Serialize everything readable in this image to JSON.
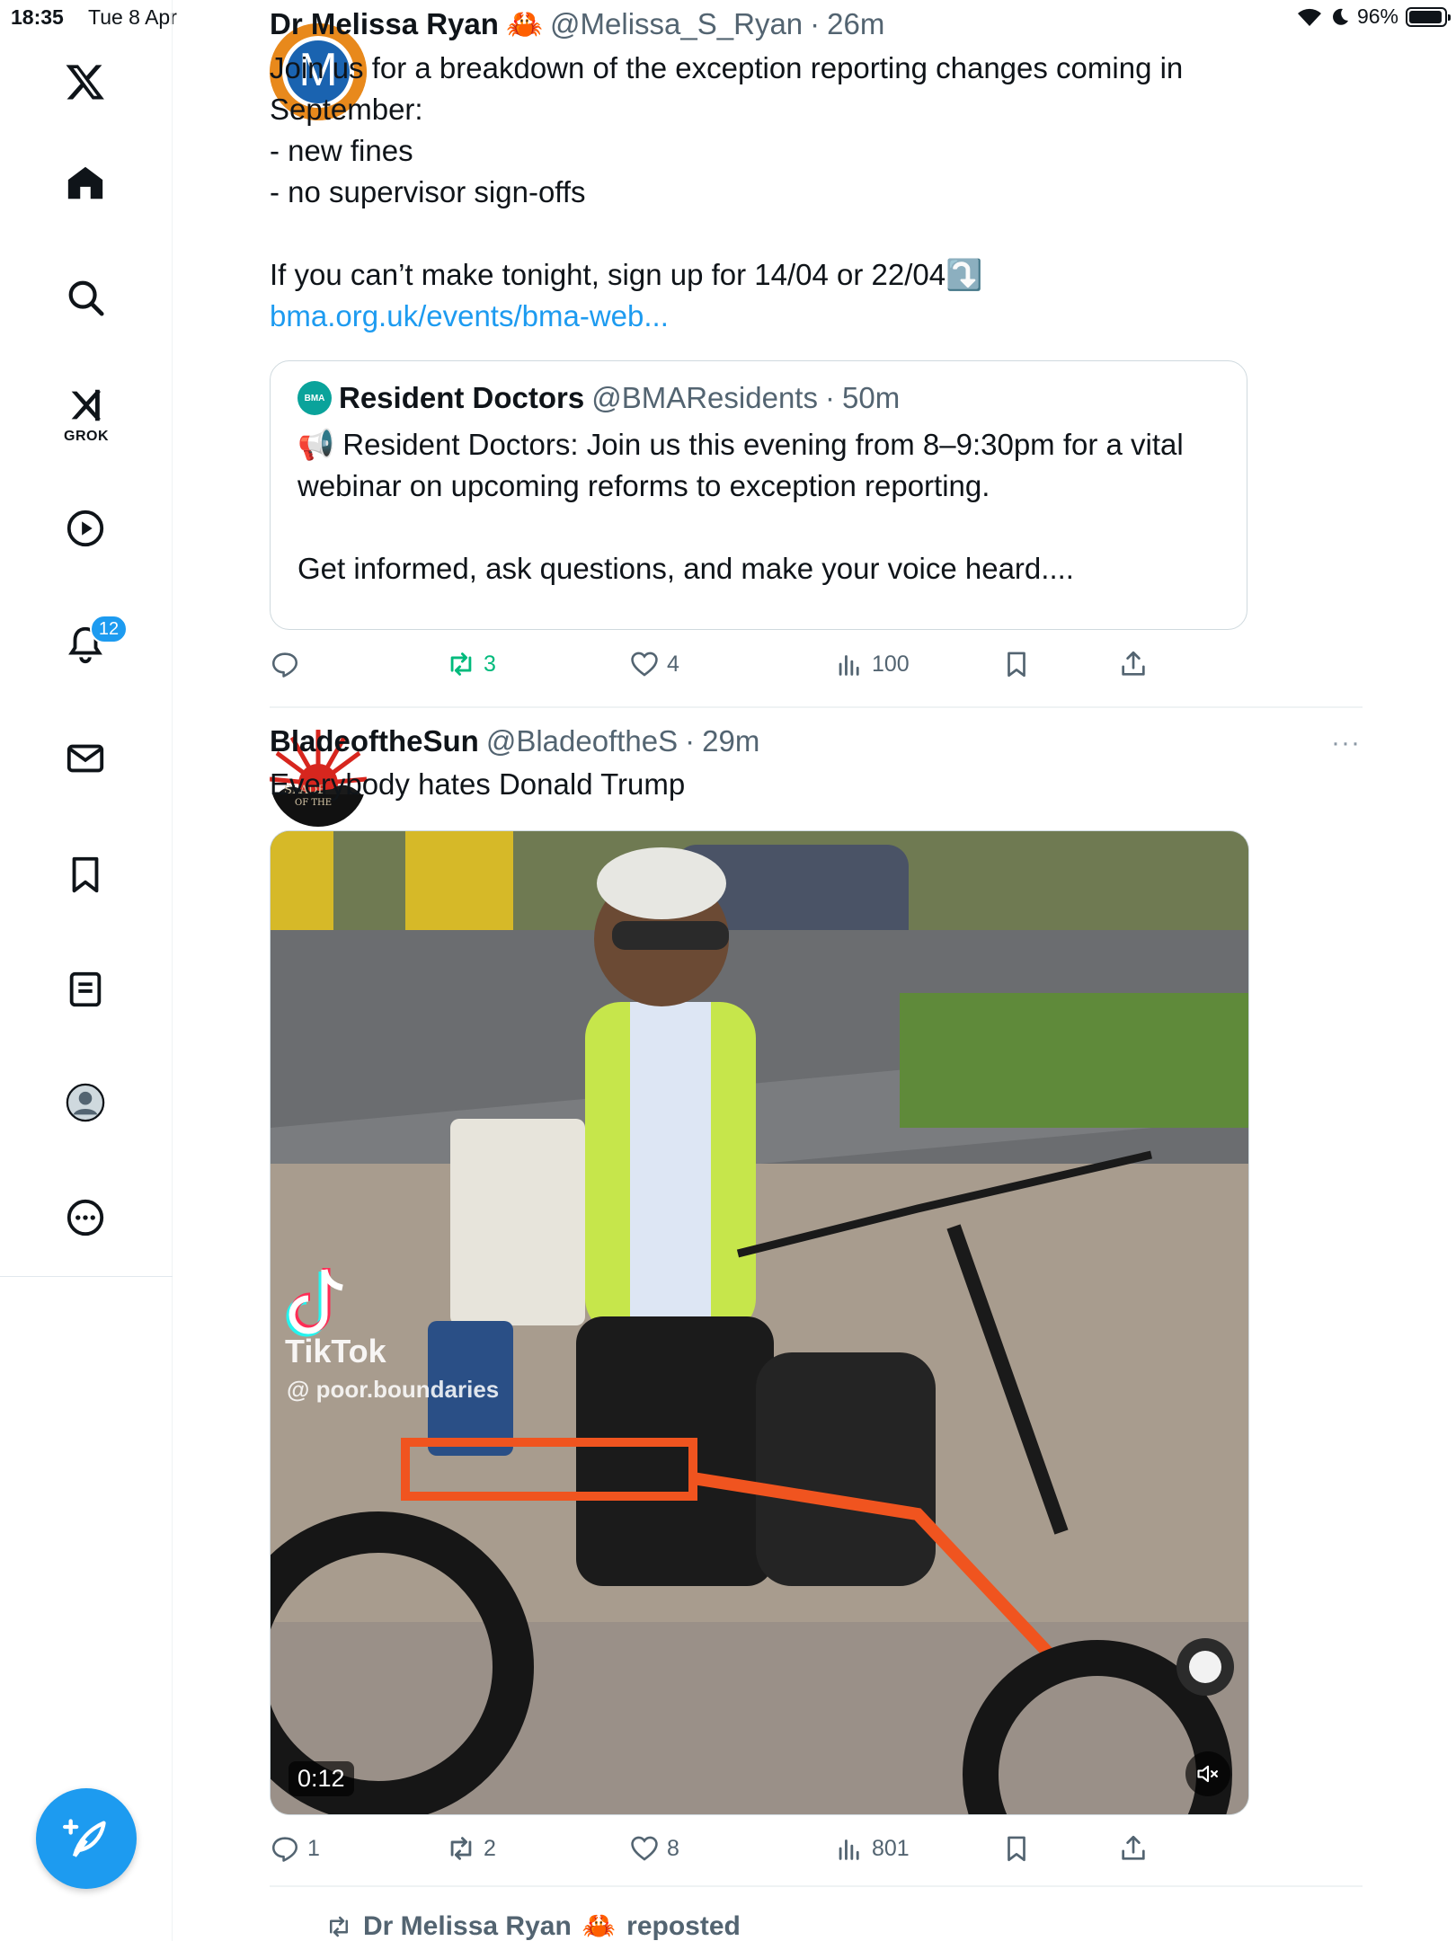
{
  "status_bar": {
    "time": "18:35",
    "date": "Tue 8 Apr",
    "battery": "96%",
    "battery_level": 0.96
  },
  "sidebar": {
    "items": [
      {
        "name": "home",
        "icon": "home-icon"
      },
      {
        "name": "explore",
        "icon": "search-icon"
      },
      {
        "name": "grok",
        "icon": "grok-icon",
        "label": "GROK"
      },
      {
        "name": "videos",
        "icon": "play-icon"
      },
      {
        "name": "notifications",
        "icon": "bell-icon",
        "badge": "12"
      },
      {
        "name": "messages",
        "icon": "mail-icon"
      },
      {
        "name": "bookmarks",
        "icon": "bookmark-icon"
      },
      {
        "name": "articles",
        "icon": "article-icon"
      },
      {
        "name": "profile",
        "icon": "profile-icon"
      },
      {
        "name": "more",
        "icon": "more-circle-icon"
      }
    ]
  },
  "tweets": [
    {
      "name": "Dr Melissa Ryan",
      "emoji": "🦀",
      "handle": "@Melissa_S_Ryan",
      "time": "26m",
      "avatar_letter": "M",
      "body_lines": [
        "Join us for a breakdown of the exception reporting changes coming in",
        "September:",
        "- new fines",
        "- no supervisor sign-offs",
        "",
        "If you can’t make tonight, sign up for 14/04 or 22/04⤵️"
      ],
      "link": "bma.org.uk/events/bma-web...",
      "quote": {
        "logo": "BMA",
        "name": "Resident Doctors",
        "handle": "@BMAResidents",
        "time": "50m",
        "body_line1": "📢 Resident Doctors: Join us this evening from 8–9:30pm for a vital",
        "body_line2": "webinar on upcoming reforms to exception reporting.",
        "body_line3": "Get informed, ask questions, and make your voice heard...."
      },
      "actions": {
        "replies": "",
        "reposts": "3",
        "likes": "4",
        "views": "100"
      }
    },
    {
      "name": "BladeoftheSun",
      "handle": "@BladeoftheS",
      "time": "29m",
      "body": "Everybody hates Donald Trump",
      "media": {
        "watermark": "TikTok",
        "watermark_user": "@ poor.boundaries",
        "duration": "0:12"
      },
      "actions": {
        "replies": "1",
        "reposts": "2",
        "likes": "8",
        "views": "801"
      }
    }
  ],
  "repost_row": {
    "name": "Dr Melissa Ryan",
    "emoji": "🦀",
    "label": "reposted"
  },
  "colors": {
    "accent": "#1d9bf0",
    "repost_green": "#00ba7c",
    "secondary_text": "#536471"
  }
}
